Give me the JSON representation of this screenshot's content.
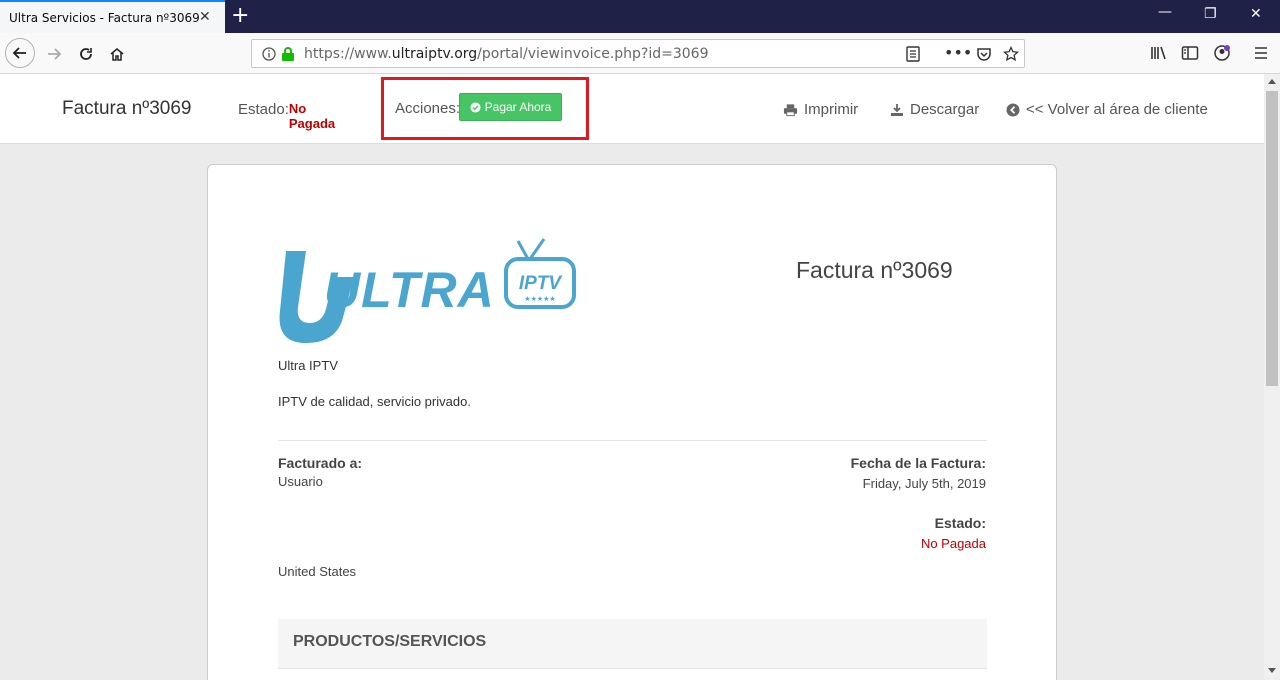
{
  "browser": {
    "tab_title": "Ultra Servicios - Factura nº3069",
    "url_prefix": "https://www.",
    "url_domain": "ultraiptv.org",
    "url_path": "/portal/viewinvoice.php?id=3069"
  },
  "header": {
    "title": "Factura nº3069",
    "status_label": "Estado:",
    "status_value": "No Pagada",
    "actions_label": "Acciones:",
    "pay_label": "Pagar Ahora",
    "print_label": "Imprimir",
    "download_label": "Descargar",
    "back_label": "<< Volver al área de cliente"
  },
  "invoice": {
    "title": "Factura nº3069",
    "logo_text": "ULTRA",
    "logo_badge": "IPTV",
    "company": "Ultra IPTV",
    "tagline": "IPTV de calidad, servicio privado.",
    "billed_to_label": "Facturado a:",
    "billed_to_name": "Usuario",
    "billed_to_country": "United States",
    "date_label": "Fecha de la Factura:",
    "date_value": "Friday, July 5th, 2019",
    "status_label": "Estado:",
    "status_value": "No Pagada",
    "products_heading": "PRODUCTOS/SERVICIOS"
  },
  "colors": {
    "brand": "#4aa6cf",
    "pay_green": "#47c463",
    "status_red": "#bb0000",
    "highlight": "#e0191f"
  }
}
